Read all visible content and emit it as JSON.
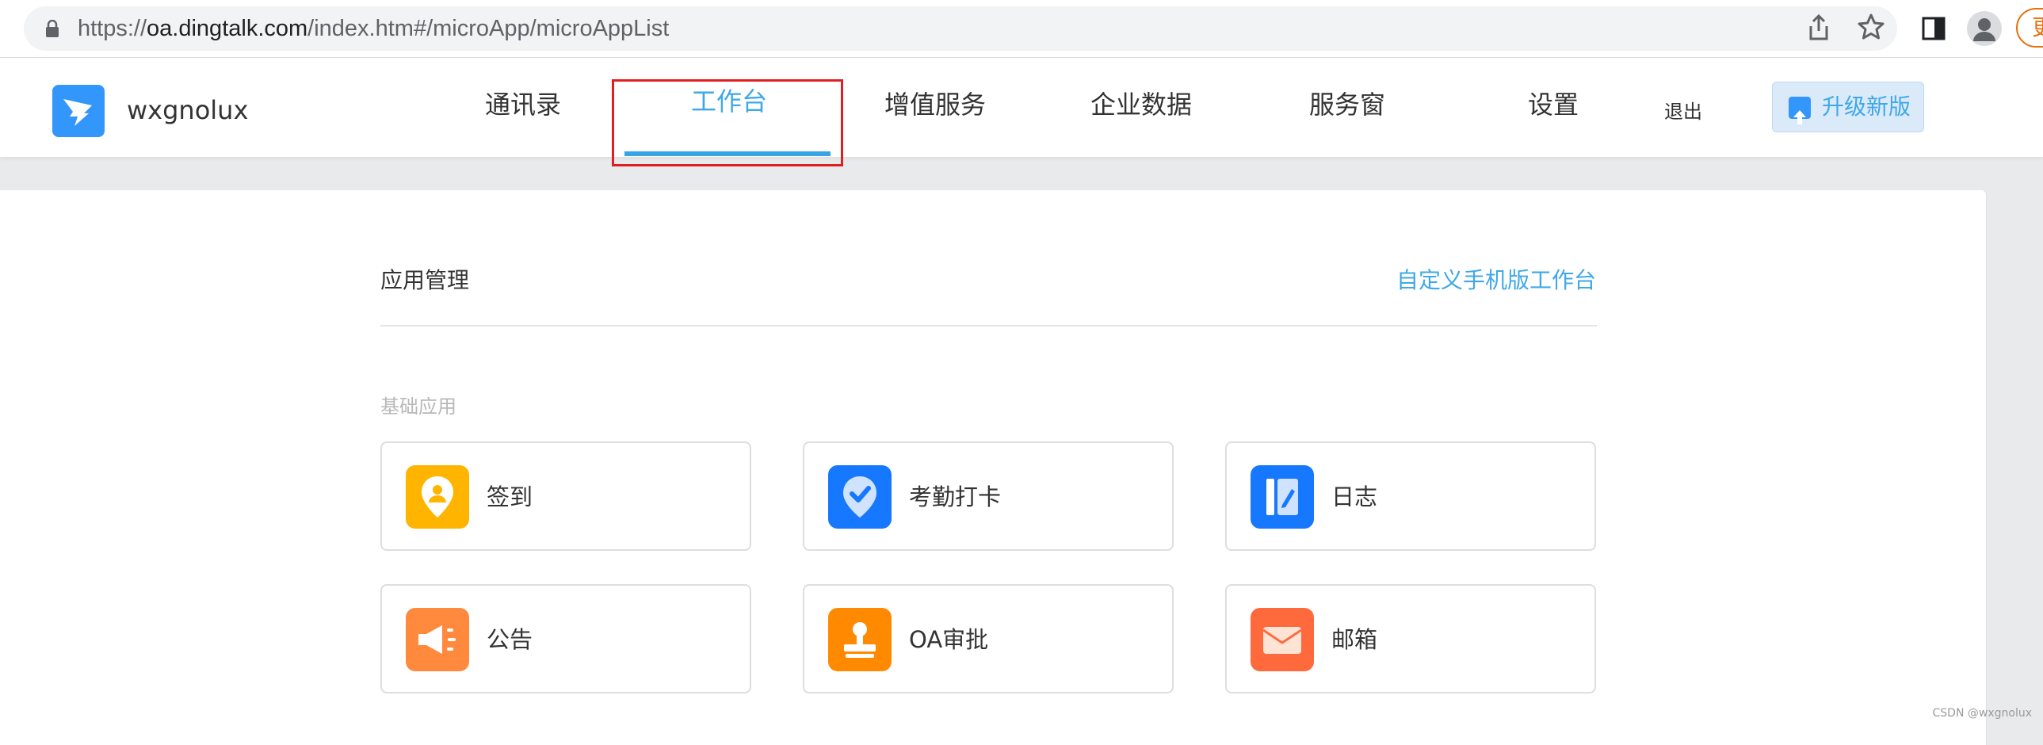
{
  "browser": {
    "url_prefix": "https://",
    "url_host": "oa.dingtalk.com",
    "url_path": "/index.htm#/microApp/microAppList",
    "update_label": "更"
  },
  "header": {
    "org_name": "wxgnolux",
    "nav": [
      {
        "label": "通讯录"
      },
      {
        "label": "工作台"
      },
      {
        "label": "增值服务"
      },
      {
        "label": "企业数据"
      },
      {
        "label": "服务窗"
      },
      {
        "label": "设置"
      }
    ],
    "active_tab": "工作台",
    "logout_label": "退出",
    "upgrade_label": "升级新版"
  },
  "main": {
    "section_title": "应用管理",
    "custom_link": "自定义手机版工作台",
    "group_label": "基础应用",
    "apps": [
      {
        "name": "签到",
        "icon": "location-person-icon",
        "color": "#ffb400"
      },
      {
        "name": "考勤打卡",
        "icon": "check-pin-icon",
        "color": "#1677ff"
      },
      {
        "name": "日志",
        "icon": "notebook-icon",
        "color": "#1677ff"
      },
      {
        "name": "公告",
        "icon": "megaphone-icon",
        "color": "#ff8a3d"
      },
      {
        "name": "OA审批",
        "icon": "stamp-icon",
        "color": "#ff8a00"
      },
      {
        "name": "邮箱",
        "icon": "envelope-icon",
        "color": "#ff6a3d"
      }
    ]
  },
  "colors": {
    "accent": "#3ea8e8",
    "highlight_box": "#e02020"
  },
  "watermark": "CSDN @wxgnolux"
}
